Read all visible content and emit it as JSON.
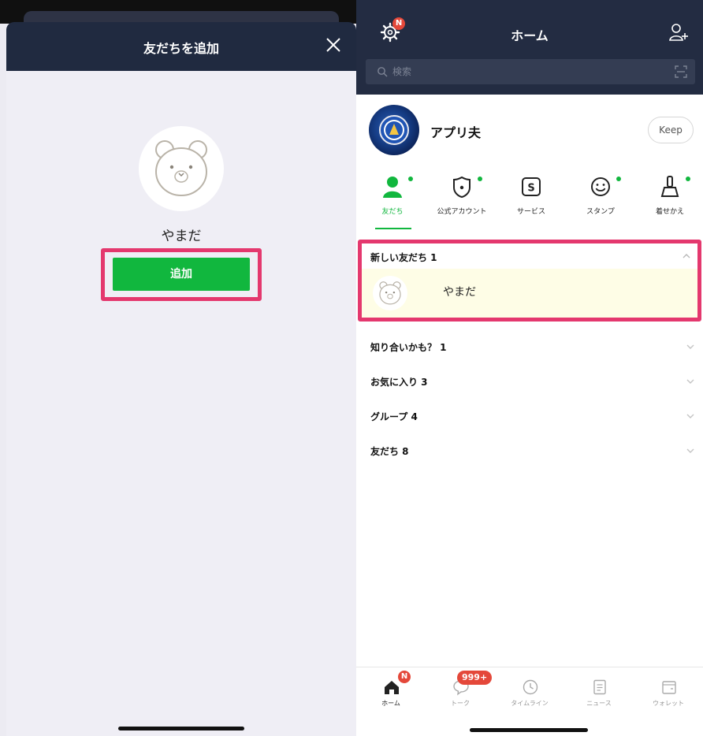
{
  "left": {
    "header_title": "友だちを追加",
    "friend_name": "やまだ",
    "add_button_label": "追加"
  },
  "right": {
    "header_title": "ホーム",
    "settings_badge": "N",
    "search_placeholder": "検索",
    "profile_name": "アプリ夫",
    "keep_label": "Keep",
    "categories": [
      {
        "label": "友だち",
        "icon": "person-icon",
        "active": true
      },
      {
        "label": "公式アカウント",
        "icon": "shield-icon"
      },
      {
        "label": "サービス",
        "icon": "service-s-icon"
      },
      {
        "label": "スタンプ",
        "icon": "smiley-icon"
      },
      {
        "label": "着せかえ",
        "icon": "theme-brush-icon"
      }
    ],
    "new_friends_header": "新しい友だち 1",
    "new_friend_name": "やまだ",
    "sections": [
      "知り合いかも？ 1",
      "お気に入り 3",
      "グループ 4",
      "友だち 8"
    ],
    "tabs": [
      {
        "label": "ホーム",
        "icon": "home-icon",
        "active": true,
        "badge": "N"
      },
      {
        "label": "トーク",
        "icon": "chat-bubble-icon",
        "badge": "999+"
      },
      {
        "label": "タイムライン",
        "icon": "clock-icon"
      },
      {
        "label": "ニュース",
        "icon": "news-icon"
      },
      {
        "label": "ウォレット",
        "icon": "wallet-icon"
      }
    ]
  },
  "colors": {
    "line_green": "#11b73e",
    "highlight_pink": "#e4386e",
    "header_navy": "#232c42",
    "badge_red": "#e4483a"
  }
}
